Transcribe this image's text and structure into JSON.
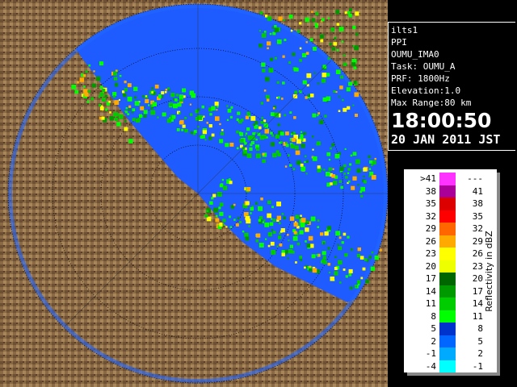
{
  "info_panel": {
    "product": "ilts1",
    "mode": "PPI",
    "site": "OUMU_IMA0",
    "task": "Task: OUMU_A",
    "prf": "PRF: 1800Hz",
    "elevation": "Elevation:1.0",
    "max_range": "Max Range:80 km",
    "time": "18:00:50",
    "date": "20 JAN 2011 JST"
  },
  "legend": {
    "title": "Reflectivity in dBZ",
    "rows": [
      {
        "lo": ">41",
        "hi": "---",
        "color": "#ff33ff"
      },
      {
        "lo": "38",
        "hi": "41",
        "color": "#aa0099"
      },
      {
        "lo": "35",
        "hi": "38",
        "color": "#dd0000"
      },
      {
        "lo": "32",
        "hi": "35",
        "color": "#ff0000"
      },
      {
        "lo": "29",
        "hi": "32",
        "color": "#ff6600"
      },
      {
        "lo": "26",
        "hi": "29",
        "color": "#ffaa00"
      },
      {
        "lo": "23",
        "hi": "26",
        "color": "#ffff00"
      },
      {
        "lo": "20",
        "hi": "23",
        "color": "#eeff00"
      },
      {
        "lo": "17",
        "hi": "20",
        "color": "#006600"
      },
      {
        "lo": "14",
        "hi": "17",
        "color": "#009900"
      },
      {
        "lo": "11",
        "hi": "14",
        "color": "#00cc00"
      },
      {
        "lo": "8",
        "hi": "11",
        "color": "#00ff00"
      },
      {
        "lo": "5",
        "hi": "8",
        "color": "#0033cc"
      },
      {
        "lo": "2",
        "hi": "5",
        "color": "#0066ff"
      },
      {
        "lo": "-1",
        "hi": "2",
        "color": "#00aaff"
      },
      {
        "lo": "-4",
        "hi": "-1",
        "color": "#00ffff"
      }
    ]
  },
  "colors": {
    "sea_background": "#1e5cff",
    "land": "#8a6a45",
    "range_rings": "#000000",
    "boundaries": "#7a4a9a"
  }
}
